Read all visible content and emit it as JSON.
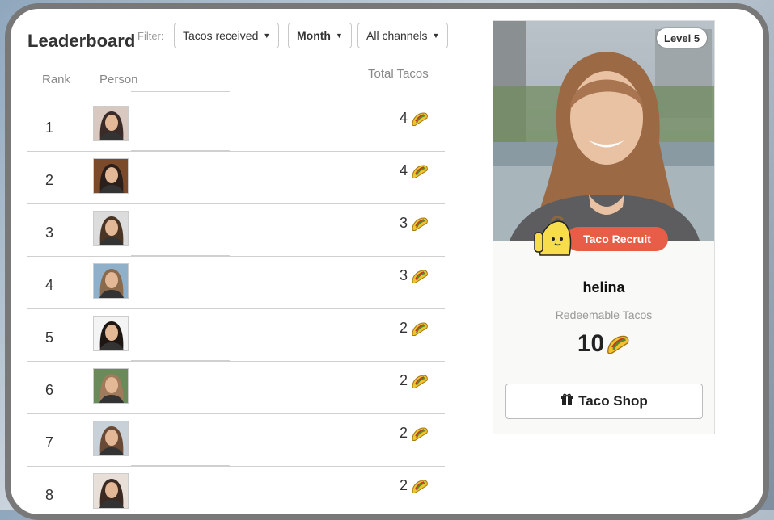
{
  "leaderboard": {
    "title": "Leaderboard",
    "filter_label": "Filter:",
    "filters": {
      "metric": "Tacos received",
      "period": "Month",
      "channel": "All channels"
    },
    "columns": {
      "rank": "Rank",
      "person": "Person",
      "total": "Total Tacos"
    },
    "rows": [
      {
        "rank": "1",
        "tacos": "4"
      },
      {
        "rank": "2",
        "tacos": "4"
      },
      {
        "rank": "3",
        "tacos": "3"
      },
      {
        "rank": "4",
        "tacos": "3"
      },
      {
        "rank": "5",
        "tacos": "2"
      },
      {
        "rank": "6",
        "tacos": "2"
      },
      {
        "rank": "7",
        "tacos": "2"
      },
      {
        "rank": "8",
        "tacos": "2"
      }
    ]
  },
  "profile": {
    "level": "Level 5",
    "badge": "Taco Recruit",
    "username": "helina",
    "redeem_label": "Redeemable Tacos",
    "redeem_value": "10",
    "shop_label": "Taco Shop"
  },
  "icons": {
    "taco": "taco-icon",
    "gift": "gift-icon",
    "caret": "chevron-down-icon"
  },
  "colors": {
    "accent": "#e85d47",
    "taco": "#f2c230",
    "frame": "#787878"
  }
}
